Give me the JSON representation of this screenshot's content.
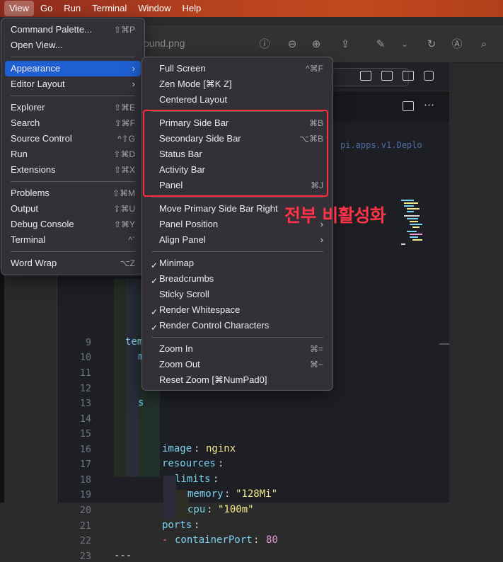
{
  "menubar": {
    "items": [
      "View",
      "Go",
      "Run",
      "Terminal",
      "Window",
      "Help"
    ]
  },
  "viewer": {
    "title": "ound.png"
  },
  "view_menu": {
    "items": [
      {
        "label": "Command Palette...",
        "shortcut": "⇧⌘P"
      },
      {
        "label": "Open View...",
        "shortcut": ""
      },
      {
        "label": "Appearance",
        "shortcut": "",
        "submenu": true
      },
      {
        "label": "Editor Layout",
        "shortcut": "",
        "submenu": true
      },
      {
        "label": "Explorer",
        "shortcut": "⇧⌘E"
      },
      {
        "label": "Search",
        "shortcut": "⇧⌘F"
      },
      {
        "label": "Source Control",
        "shortcut": "^⇧G"
      },
      {
        "label": "Run",
        "shortcut": "⇧⌘D"
      },
      {
        "label": "Extensions",
        "shortcut": "⇧⌘X"
      },
      {
        "label": "Problems",
        "shortcut": "⇧⌘M"
      },
      {
        "label": "Output",
        "shortcut": "⇧⌘U"
      },
      {
        "label": "Debug Console",
        "shortcut": "⇧⌘Y"
      },
      {
        "label": "Terminal",
        "shortcut": "^`"
      },
      {
        "label": "Word Wrap",
        "shortcut": "⌥Z"
      }
    ]
  },
  "appearance_menu": {
    "items": [
      {
        "label": "Full Screen",
        "shortcut": "^⌘F"
      },
      {
        "label": "Zen Mode [⌘K Z]",
        "shortcut": ""
      },
      {
        "label": "Centered Layout",
        "shortcut": ""
      },
      {
        "label": "Primary Side Bar",
        "shortcut": "⌘B"
      },
      {
        "label": "Secondary Side Bar",
        "shortcut": "⌥⌘B"
      },
      {
        "label": "Status Bar",
        "shortcut": ""
      },
      {
        "label": "Activity Bar",
        "shortcut": ""
      },
      {
        "label": "Panel",
        "shortcut": "⌘J"
      },
      {
        "label": "Move Primary Side Bar Right",
        "shortcut": ""
      },
      {
        "label": "Panel Position",
        "shortcut": ""
      },
      {
        "label": "Align Panel",
        "shortcut": ""
      },
      {
        "label": "Minimap",
        "shortcut": "",
        "checked": true
      },
      {
        "label": "Breadcrumbs",
        "shortcut": "",
        "checked": true
      },
      {
        "label": "Sticky Scroll",
        "shortcut": ""
      },
      {
        "label": "Render Whitespace",
        "shortcut": "",
        "checked": true
      },
      {
        "label": "Render Control Characters",
        "shortcut": "",
        "checked": true
      },
      {
        "label": "Zoom In",
        "shortcut": "⌘="
      },
      {
        "label": "Zoom Out",
        "shortcut": "⌘−"
      },
      {
        "label": "Reset Zoom [⌘NumPad0]",
        "shortcut": ""
      }
    ]
  },
  "annotation": {
    "text": "전부 비활성화",
    "color": "#ff3347"
  },
  "editor": {
    "breadcrumb_fragment": "pi.apps.v1.Deplo",
    "line_numbers": [
      "9",
      "10",
      "11",
      "12",
      "13",
      "14",
      "15",
      "16",
      "17",
      "18",
      "19",
      "20",
      "21",
      "22",
      "23"
    ],
    "lines": {
      "l9": "tem",
      "l10": "m",
      "l13": "s",
      "l16_key": "image",
      "l16_val": "nginx",
      "l17_key": "resources",
      "l18_key": "limits",
      "l19_key": "memory",
      "l19_val": "\"128Mi\"",
      "l20_key": "cpu",
      "l20_val": "\"100m\"",
      "l21_key": "ports",
      "l22_dash": "-",
      "l22_key": "containerPort",
      "l22_val": "80",
      "l23": "---"
    }
  },
  "colors": {
    "highlight": "#1f5fd1",
    "annotation_box": "#ff2d3f"
  }
}
